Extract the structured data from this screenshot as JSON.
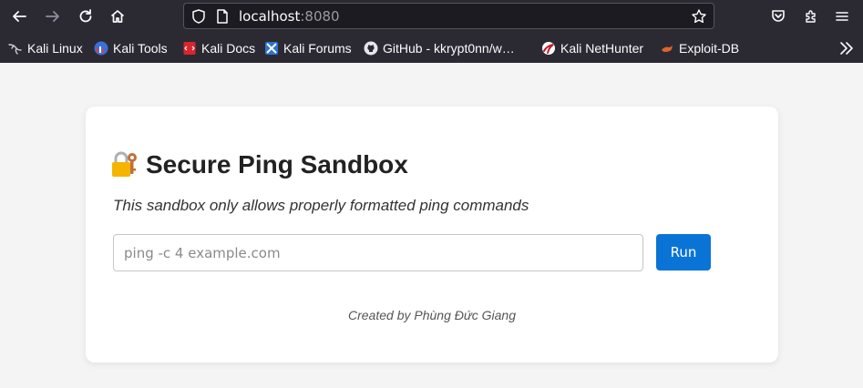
{
  "browser": {
    "url_host": "localhost",
    "url_port": ":8080",
    "bookmarks": [
      {
        "label": "Kali Linux",
        "icon": "kali-dragon-icon"
      },
      {
        "label": "Kali Tools",
        "icon": "kali-tools-icon"
      },
      {
        "label": "Kali Docs",
        "icon": "kali-docs-icon"
      },
      {
        "label": "Kali Forums",
        "icon": "kali-forums-icon"
      },
      {
        "label": "GitHub - kkrypt0nn/w…",
        "icon": "github-icon"
      },
      {
        "label": "Kali NetHunter",
        "icon": "nethunter-icon"
      },
      {
        "label": "Exploit-DB",
        "icon": "exploit-db-icon"
      }
    ]
  },
  "page": {
    "title": "Secure Ping Sandbox",
    "title_icon": "lock-with-key-icon",
    "subtitle": "This sandbox only allows properly formatted ping commands",
    "input_placeholder": "ping -c 4 example.com",
    "input_value": "",
    "run_label": "Run",
    "credit": "Created by Phùng Đức Giang"
  },
  "colors": {
    "chrome_bg": "#2b2a33",
    "urlbar_bg": "#1c1b22",
    "page_bg": "#f4f4f4",
    "accent": "#0a74d6"
  }
}
